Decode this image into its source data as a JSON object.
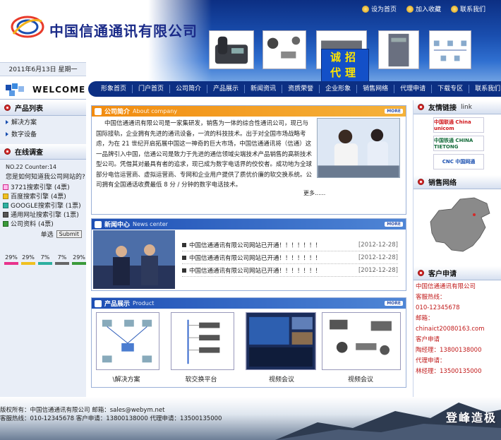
{
  "header": {
    "company_name": "中国信通通讯有限公司",
    "top_links": [
      {
        "label": "设为首页",
        "icon": "home-icon"
      },
      {
        "label": "加入收藏",
        "icon": "star-icon"
      },
      {
        "label": "联系我们",
        "icon": "contact-icon"
      }
    ],
    "recruit_line1": "诚招",
    "recruit_line2": "代理",
    "date": "2011年6月13日 星期一",
    "welcome": "WELCOME",
    "colors": {
      "primary": "#0c2f83",
      "accent": "#f28c10",
      "contact_red": "#c01818"
    }
  },
  "nav": {
    "items": [
      "形象首页",
      "门户首页",
      "公司简介",
      "产品展示",
      "新闻资讯",
      "资质荣誉",
      "企业形象",
      "销售网络",
      "代理申请",
      "下载专区",
      "联系我们"
    ]
  },
  "left": {
    "product_list_title": "产品列表",
    "product_items": [
      "解决方案",
      "数字设备"
    ],
    "survey_title": "在线调查",
    "survey_no": "NO.22",
    "survey_counter": "Counter:14",
    "survey_question": "您是如何知道我公司网站的?",
    "options": [
      {
        "label": "3721搜索引擎",
        "votes": "(4票)",
        "checked": true
      },
      {
        "label": "百度搜索引擎",
        "votes": "(4票)",
        "checked": false
      },
      {
        "label": "GOOGLE搜索引擎",
        "votes": "(1票)",
        "checked": false
      },
      {
        "label": "通用网址搜索引擎",
        "votes": "(1票)",
        "checked": false
      },
      {
        "label": "公司资料",
        "votes": "(4票)",
        "checked": false
      }
    ],
    "single_label": "单选",
    "submit_label": "Submit",
    "results": [
      {
        "pct": "29%",
        "color": "#e8338c"
      },
      {
        "pct": "29%",
        "color": "#f0c020"
      },
      {
        "pct": "7%",
        "color": "#2db0a0"
      },
      {
        "pct": "7%",
        "color": "#666666"
      },
      {
        "pct": "29%",
        "color": "#3a9a3a"
      }
    ]
  },
  "about": {
    "title": "公司简介",
    "title_en": "About company",
    "more_tag": "MORE",
    "text": "中国信通通讯有限公司是一家集研发，销售为一体的综合性通讯公司，现已与国际接轨，企业拥有先进的通讯设备，一流的科技技术。出于对全国市场战略考虑，为在 21 世纪开启拓展中国这一神奇的巨大市场，中国信通通讯将（信通）这一品牌引入中国，信通公司是致力于先进的通信领域尖端技术产品销售的高新技术型公司。凭借其对最具有者的追求，现已成为数字电话界的佼佼者。成功地为全球部分电信运营商、虚拟运营商、专网和企业用户提供了质优价廉的软交换系统。公司拥有全国通话收费最低 8 分 / 分钟的数字电话技术。",
    "more_link": "更多......"
  },
  "news": {
    "title": "新闻中心",
    "title_en": "News center",
    "more_tag": "MORE",
    "items": [
      {
        "title": "中国信通通讯有限公司网站已开通！！！！！！！",
        "date": "[2012-12-28]"
      },
      {
        "title": "中国信通通讯有限公司网站已开通！！！！！！！",
        "date": "[2012-12-28]"
      },
      {
        "title": "中国信通通讯有限公司网站已开通！！！！！！！",
        "date": "[2012-12-28]"
      }
    ]
  },
  "products": {
    "title": "产品展示",
    "title_en": "Product",
    "more_tag": "MORE",
    "items": [
      "\\解决方案",
      "软交换平台",
      "视频会议",
      "视频会议"
    ]
  },
  "right": {
    "links_title": "友情链接",
    "links_title_en": "link",
    "partners": [
      "中国联通 China unicom",
      "中国铁通 CHINA TIETONG",
      "CNC 中国网通"
    ],
    "sales_title": "销售网络",
    "apply_title": "客户申请",
    "contact": [
      "中国信通通讯有限公司",
      "客服热线：",
      "010-12345678",
      "邮箱：",
      "chinaict20080163.com",
      "客户申请",
      "陶经理：13800138000",
      "代理申请：",
      "林经理：13500135000"
    ]
  },
  "footer": {
    "line1": "版权所有：中国信通通讯有限公司  邮箱：sales@webym.net",
    "line2": "客服热线：010-12345678  客户申请：13800138000  代理申请：13500135000",
    "slogan": "登峰造极"
  }
}
